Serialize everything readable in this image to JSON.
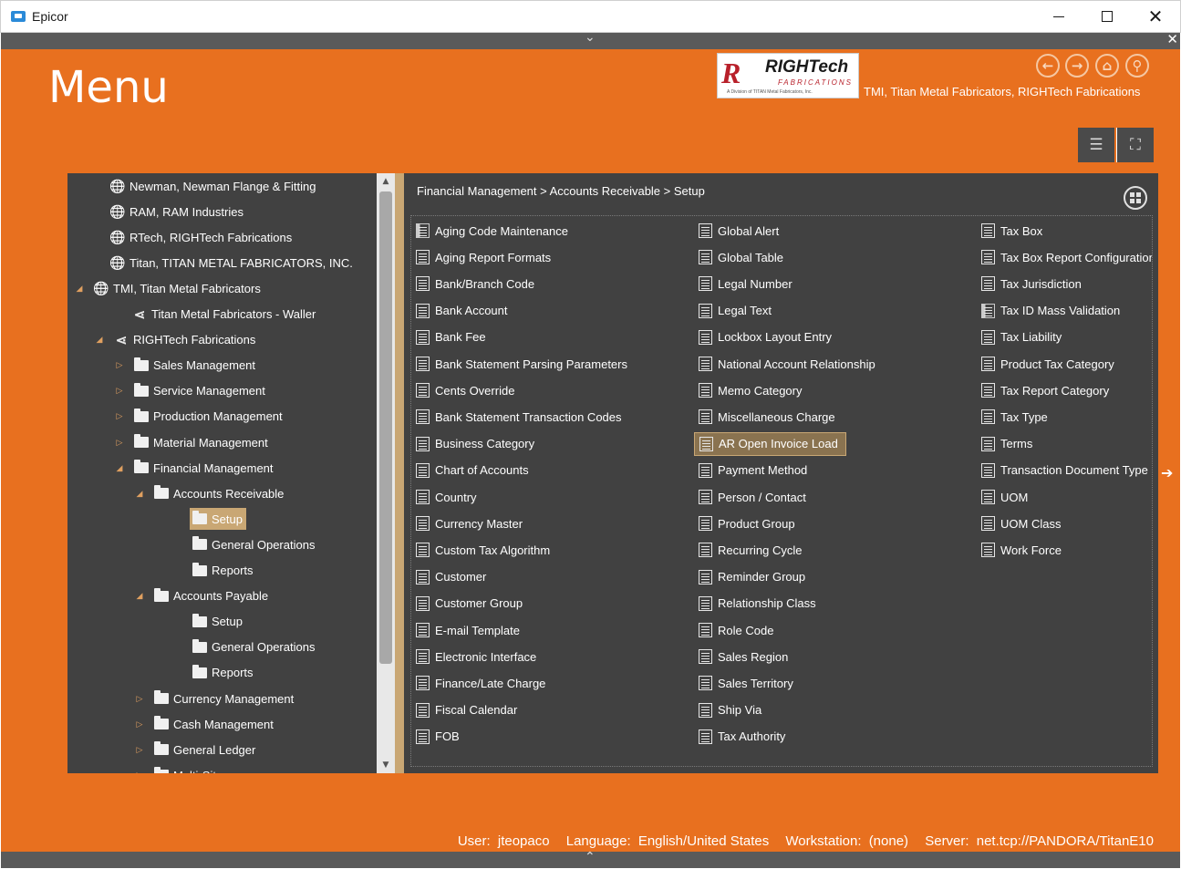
{
  "window": {
    "title": "Epicor",
    "close_glyph": "✕"
  },
  "header": {
    "menu_title": "Menu",
    "logo": {
      "mark": "R",
      "name": "RIGHTech",
      "sub": "FABRICATIONS",
      "tiny": "A Division of TITAN Metal Fabricators, Inc."
    },
    "company_line": "TMI, Titan Metal Fabricators, RIGHTech Fabrications",
    "nav_icons": [
      "back-icon",
      "forward-icon",
      "home-icon",
      "search-icon"
    ]
  },
  "tree": {
    "items": [
      {
        "label": "Newman, Newman Flange & Fitting",
        "icon": "globe-icon",
        "expander": ""
      },
      {
        "label": "RAM, RAM Industries",
        "icon": "globe-icon",
        "expander": ""
      },
      {
        "label": "RTech, RIGHTech Fabrications",
        "icon": "globe-icon",
        "expander": ""
      },
      {
        "label": "Titan, TITAN METAL FABRICATORS, INC.",
        "icon": "globe-icon",
        "expander": ""
      },
      {
        "label": "TMI, Titan Metal Fabricators",
        "icon": "globe-icon",
        "expander": "◢"
      },
      {
        "label": "Titan Metal Fabricators - Waller",
        "icon": "share-icon",
        "expander": ""
      },
      {
        "label": "RIGHTech Fabrications",
        "icon": "share-icon",
        "expander": "◢"
      },
      {
        "label": "Sales Management",
        "icon": "folder-icon",
        "expander": "▷"
      },
      {
        "label": "Service Management",
        "icon": "folder-icon",
        "expander": "▷"
      },
      {
        "label": "Production Management",
        "icon": "folder-icon",
        "expander": "▷"
      },
      {
        "label": "Material Management",
        "icon": "folder-icon",
        "expander": "▷"
      },
      {
        "label": "Financial Management",
        "icon": "folder-icon",
        "expander": "◢"
      },
      {
        "label": "Accounts Receivable",
        "icon": "folder-icon",
        "expander": "◢"
      },
      {
        "label": "Setup",
        "icon": "folder-icon",
        "expander": "",
        "selected": true
      },
      {
        "label": "General Operations",
        "icon": "folder-icon",
        "expander": ""
      },
      {
        "label": "Reports",
        "icon": "folder-icon",
        "expander": ""
      },
      {
        "label": "Accounts Payable",
        "icon": "folder-icon",
        "expander": "◢"
      },
      {
        "label": "Setup",
        "icon": "folder-icon",
        "expander": ""
      },
      {
        "label": "General Operations",
        "icon": "folder-icon",
        "expander": ""
      },
      {
        "label": "Reports",
        "icon": "folder-icon",
        "expander": ""
      },
      {
        "label": "Currency Management",
        "icon": "folder-icon",
        "expander": "▷"
      },
      {
        "label": "Cash Management",
        "icon": "folder-icon",
        "expander": "▷"
      },
      {
        "label": "General Ledger",
        "icon": "folder-icon",
        "expander": "▷"
      },
      {
        "label": "Multi-Site",
        "icon": "folder-icon",
        "expander": "▷"
      }
    ]
  },
  "breadcrumb": [
    "Financial Management",
    "Accounts Receivable",
    "Setup"
  ],
  "columns": [
    [
      {
        "label": "Aging Code Maintenance",
        "icon": "table-icon"
      },
      {
        "label": "Aging Report Formats",
        "icon": "document-icon"
      },
      {
        "label": "Bank/Branch Code",
        "icon": "document-icon"
      },
      {
        "label": "Bank Account",
        "icon": "document-icon"
      },
      {
        "label": "Bank Fee",
        "icon": "document-icon"
      },
      {
        "label": "Bank Statement Parsing Parameters",
        "icon": "document-icon"
      },
      {
        "label": "Cents Override",
        "icon": "document-icon"
      },
      {
        "label": "Bank Statement Transaction Codes",
        "icon": "document-icon"
      },
      {
        "label": "Business Category",
        "icon": "document-icon"
      },
      {
        "label": "Chart of Accounts",
        "icon": "document-icon"
      },
      {
        "label": "Country",
        "icon": "document-icon"
      },
      {
        "label": "Currency Master",
        "icon": "document-icon"
      },
      {
        "label": "Custom Tax Algorithm",
        "icon": "document-icon"
      },
      {
        "label": "Customer",
        "icon": "document-icon"
      },
      {
        "label": "Customer Group",
        "icon": "document-icon"
      },
      {
        "label": "E-mail Template",
        "icon": "document-icon"
      },
      {
        "label": "Electronic Interface",
        "icon": "document-icon"
      },
      {
        "label": "Finance/Late Charge",
        "icon": "document-icon"
      },
      {
        "label": "Fiscal Calendar",
        "icon": "document-icon"
      },
      {
        "label": "FOB",
        "icon": "document-icon"
      }
    ],
    [
      {
        "label": "Global Alert",
        "icon": "document-icon"
      },
      {
        "label": "Global Table",
        "icon": "document-icon"
      },
      {
        "label": "Legal Number",
        "icon": "document-icon"
      },
      {
        "label": "Legal Text",
        "icon": "document-icon"
      },
      {
        "label": "Lockbox Layout Entry",
        "icon": "document-icon"
      },
      {
        "label": "National Account Relationship",
        "icon": "document-icon"
      },
      {
        "label": "Memo Category",
        "icon": "document-icon"
      },
      {
        "label": "Miscellaneous Charge",
        "icon": "document-icon"
      },
      {
        "label": "AR Open Invoice Load",
        "icon": "document-icon",
        "selected": true
      },
      {
        "label": "Payment Method",
        "icon": "document-icon"
      },
      {
        "label": "Person / Contact",
        "icon": "document-icon"
      },
      {
        "label": "Product Group",
        "icon": "document-icon"
      },
      {
        "label": "Recurring Cycle",
        "icon": "document-icon"
      },
      {
        "label": "Reminder Group",
        "icon": "document-icon"
      },
      {
        "label": "Relationship Class",
        "icon": "document-icon"
      },
      {
        "label": "Role Code",
        "icon": "document-icon"
      },
      {
        "label": "Sales Region",
        "icon": "document-icon"
      },
      {
        "label": "Sales Territory",
        "icon": "document-icon"
      },
      {
        "label": "Ship Via",
        "icon": "document-icon"
      },
      {
        "label": "Tax Authority",
        "icon": "document-icon"
      }
    ],
    [
      {
        "label": "Tax Box",
        "icon": "document-icon"
      },
      {
        "label": "Tax Box Report Configuration",
        "icon": "document-icon"
      },
      {
        "label": "Tax Jurisdiction",
        "icon": "document-icon"
      },
      {
        "label": "Tax ID Mass Validation",
        "icon": "table-icon"
      },
      {
        "label": "Tax Liability",
        "icon": "document-icon"
      },
      {
        "label": "Product Tax Category",
        "icon": "document-icon"
      },
      {
        "label": "Tax Report Category",
        "icon": "document-icon"
      },
      {
        "label": "Tax Type",
        "icon": "document-icon"
      },
      {
        "label": "Terms",
        "icon": "document-icon"
      },
      {
        "label": "Transaction Document Type",
        "icon": "document-icon"
      },
      {
        "label": "UOM",
        "icon": "document-icon"
      },
      {
        "label": "UOM Class",
        "icon": "document-icon"
      },
      {
        "label": "Work Force",
        "icon": "document-icon"
      }
    ]
  ],
  "status": {
    "user_label": "User:",
    "user": "jteopaco",
    "language_label": "Language:",
    "language": "English/United States",
    "workstation_label": "Workstation:",
    "workstation": "(none)",
    "server_label": "Server:",
    "server": "net.tcp://PANDORA/TitanE10"
  },
  "colors": {
    "accent": "#e8701f",
    "panel": "#414141",
    "selection": "#c9a774"
  }
}
